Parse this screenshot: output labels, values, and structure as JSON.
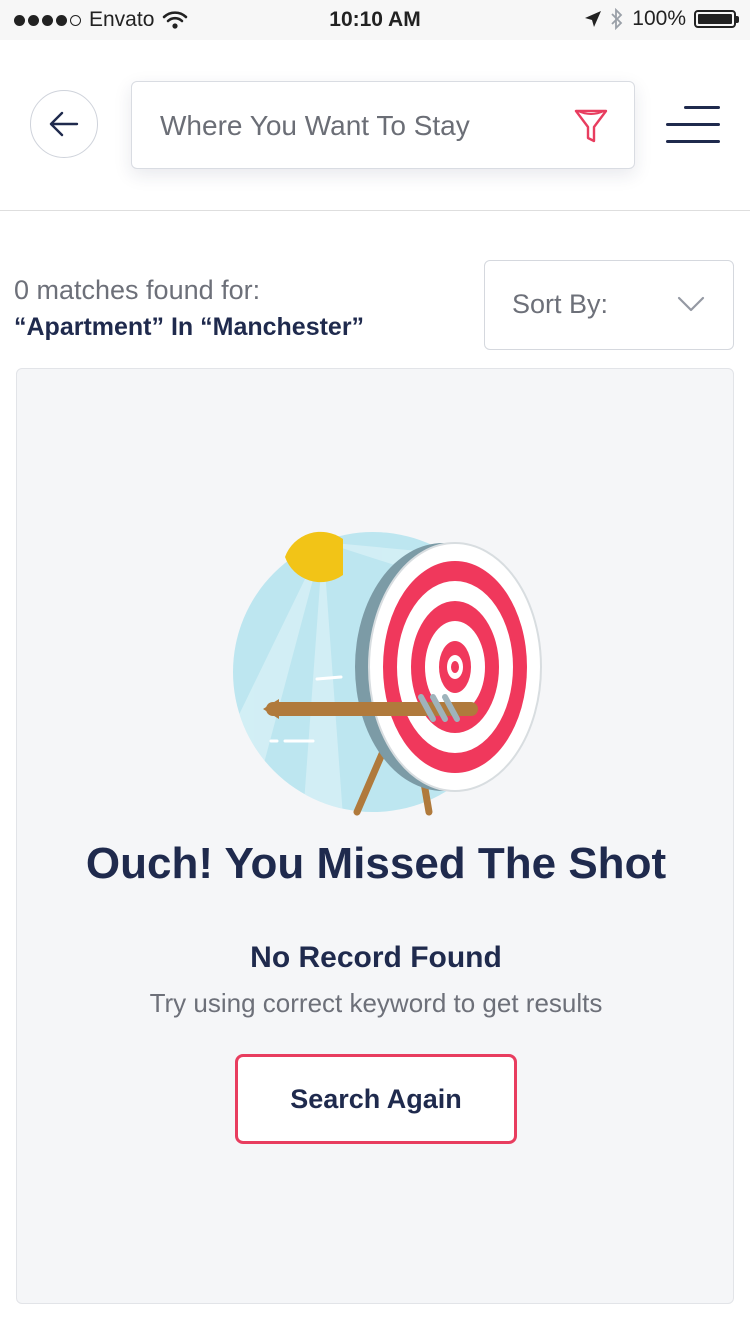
{
  "status_bar": {
    "carrier": "Envato",
    "time": "10:10 AM",
    "battery": "100%"
  },
  "header": {
    "search": {
      "placeholder": "Where You Want To Stay",
      "value": ""
    }
  },
  "results": {
    "count_text": "0 matches found for:",
    "query_text": "“Apartment” In “Manchester”",
    "sort_label": "Sort By:"
  },
  "empty_state": {
    "title": "Ouch! You Missed The Shot",
    "subtitle": "No Record Found",
    "hint": "Try using correct keyword to get results",
    "button_label": "Search Again"
  },
  "colors": {
    "accent": "#e83d5f",
    "text_primary": "#1f2a4d",
    "text_secondary": "#6d7079",
    "card_background": "#f5f6f8"
  },
  "icons": {
    "back": "arrow-left-icon",
    "filter": "funnel-icon",
    "menu": "hamburger-menu-icon",
    "sort": "chevron-down-icon",
    "illustration": "target-with-arrow-illustration"
  }
}
